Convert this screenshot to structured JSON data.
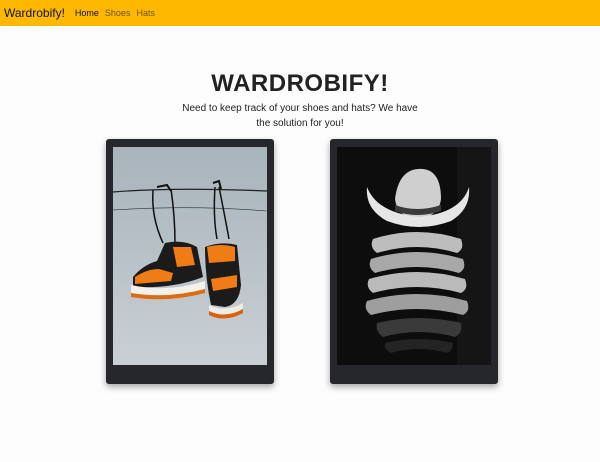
{
  "navbar": {
    "brand": "Wardrobify!",
    "links": [
      {
        "label": "Home",
        "active": true
      },
      {
        "label": "Shoes",
        "active": false
      },
      {
        "label": "Hats",
        "active": false
      }
    ],
    "background": "#ffb800"
  },
  "hero": {
    "title": "WARDROBIFY!",
    "subtitle": "Need to keep track of your shoes and hats? We have the solution for you!"
  },
  "cards": [
    {
      "image": "sneakers-hanging-on-wire-photo"
    },
    {
      "image": "stacked-cowboy-hats-photo"
    }
  ]
}
